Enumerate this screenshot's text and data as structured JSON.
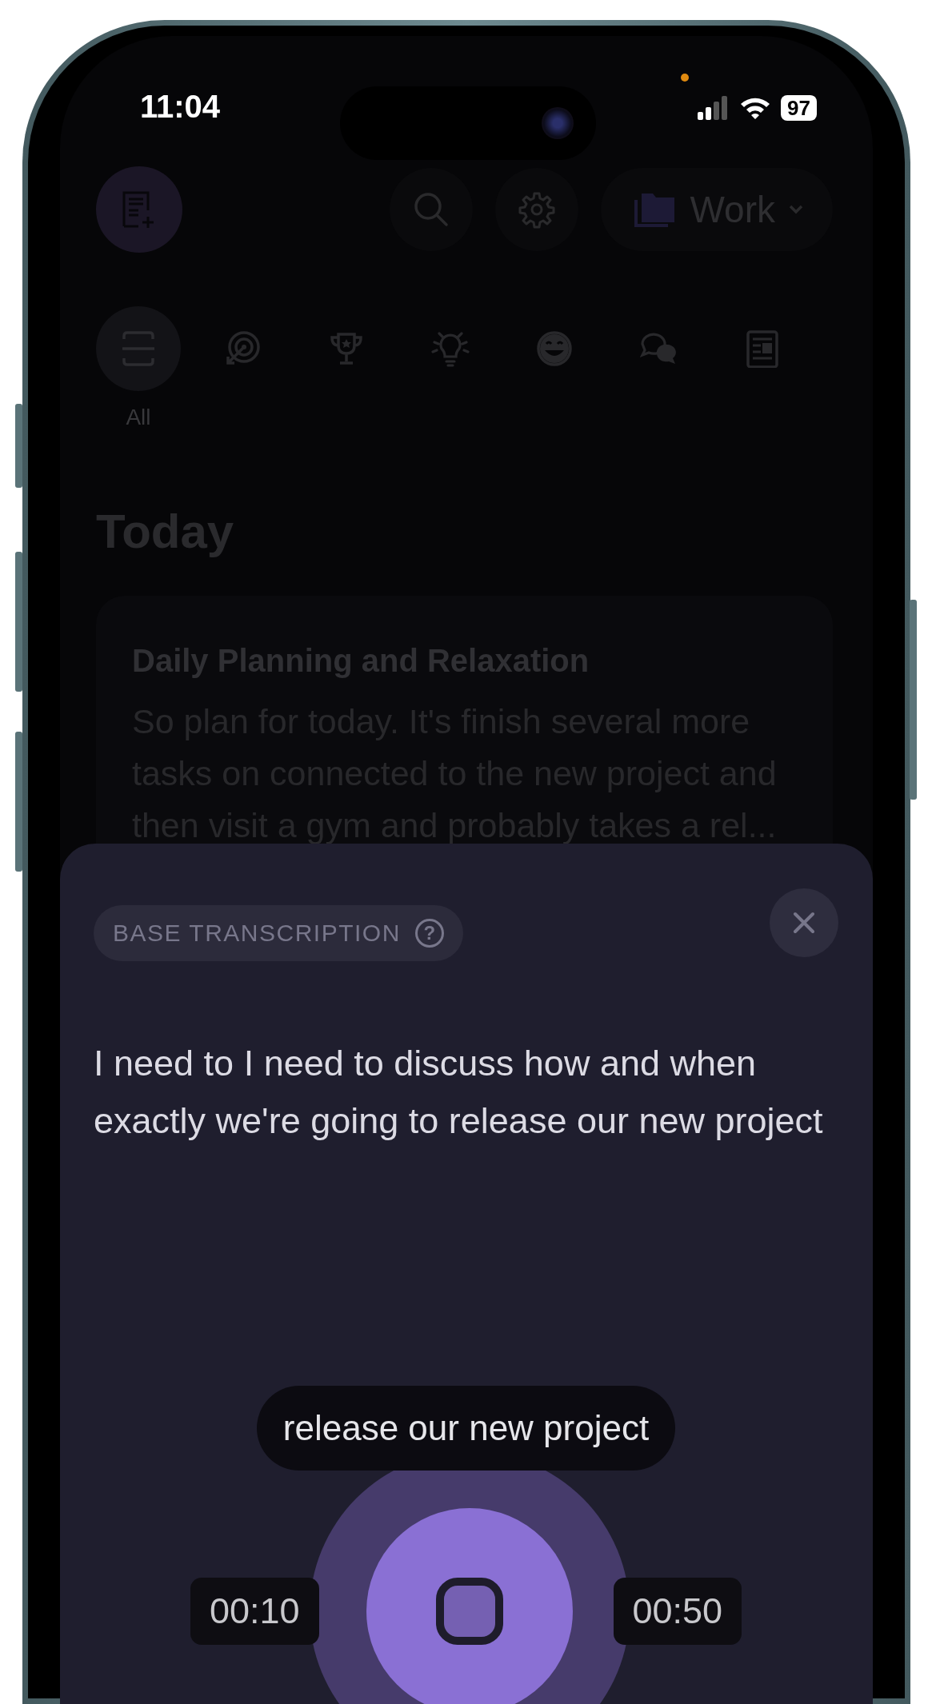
{
  "status_bar": {
    "time": "11:04",
    "battery": "97"
  },
  "header": {
    "folder": "Work"
  },
  "categories": [
    {
      "kind": "all",
      "label": "All",
      "selected": true
    },
    {
      "kind": "target",
      "selected": false
    },
    {
      "kind": "trophy",
      "selected": false
    },
    {
      "kind": "idea",
      "selected": false
    },
    {
      "kind": "smile",
      "selected": false
    },
    {
      "kind": "chat",
      "selected": false
    },
    {
      "kind": "notes",
      "selected": false
    }
  ],
  "section_title": "Today",
  "notes": [
    {
      "title": "Daily Planning and Relaxation",
      "preview": "So plan for today. It's finish several more tasks on connected to the new project and then visit a gym and probably takes a rel..."
    }
  ],
  "sheet": {
    "badge": "BASE TRANSCRIPTION",
    "help": "?",
    "transcript": "I need to I need to discuss how and when exactly we're going to release our new project",
    "live_caption": "release our new project",
    "elapsed": "00:10",
    "remaining": "00:50",
    "recording": true
  }
}
